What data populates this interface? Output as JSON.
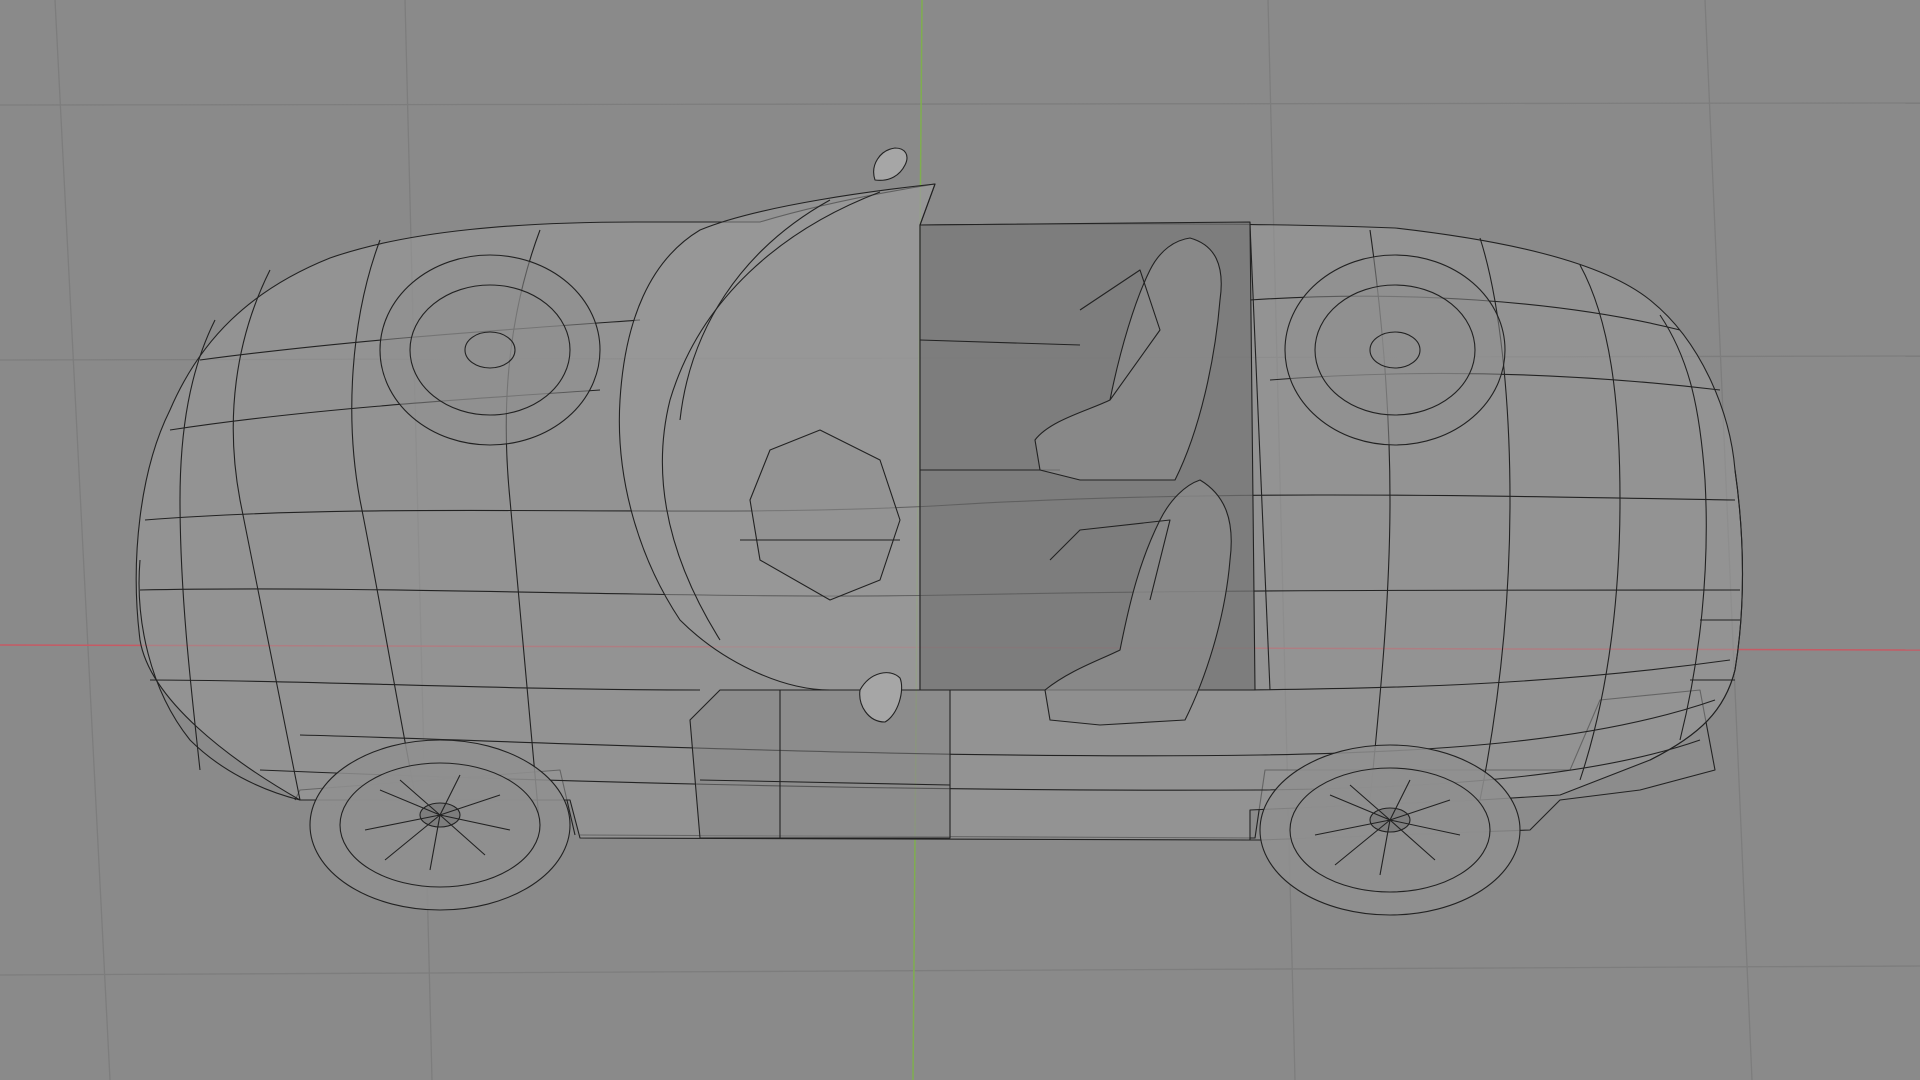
{
  "viewport": {
    "mode": "wireframe",
    "view": "side",
    "background_color": "#8a8a8a",
    "grid_color": "#7d7d7d",
    "x_axis_color": "#c65a64",
    "z_axis_color": "#7fae4f"
  },
  "model": {
    "subject": "convertible-sports-car",
    "wire_color": "#222222",
    "body_fill": "#9a9a9a",
    "interior_fill": "#767676",
    "wheel_count": 4
  }
}
